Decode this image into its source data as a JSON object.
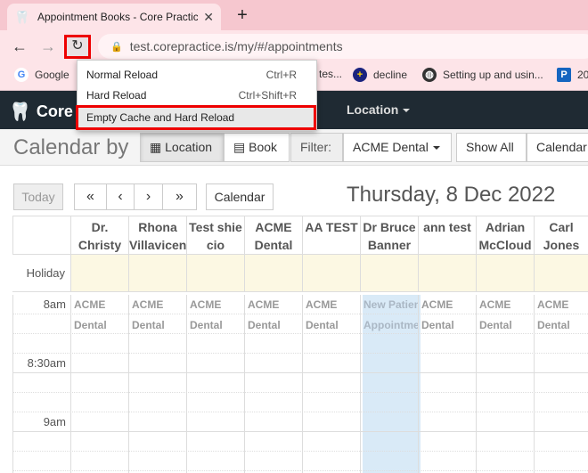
{
  "browser": {
    "tab_title": "Appointment Books - Core Practic",
    "url": "test.corepractice.is/my/#/appointments",
    "bookmarks": [
      "Google",
      "tes...",
      "decline",
      "Setting up and usin...",
      "20"
    ]
  },
  "reload_menu": {
    "items": [
      {
        "label": "Normal Reload",
        "shortcut": "Ctrl+R"
      },
      {
        "label": "Hard Reload",
        "shortcut": "Ctrl+Shift+R"
      },
      {
        "label": "Empty Cache and Hard Reload",
        "shortcut": ""
      }
    ]
  },
  "app": {
    "logo_text": "Core",
    "location_menu": "Location"
  },
  "toolbar": {
    "calendar_by": "Calendar by",
    "location_btn": "Location",
    "book_btn": "Book",
    "filter_label": "Filter:",
    "filter_value": "ACME Dental",
    "show_all": "Show All",
    "calendar_btn": "Calendar"
  },
  "calendar": {
    "today": "Today",
    "prev_week": "«",
    "prev_day": "‹",
    "next_day": "›",
    "next_week": "»",
    "calendar_btn": "Calendar",
    "date": "Thursday, 8 Dec 2022",
    "holiday_label": "Holiday",
    "columns": [
      {
        "l1": "Dr.",
        "l2": "Christy"
      },
      {
        "l1": "Rhona",
        "l2": "Villavicencio"
      },
      {
        "l1": "Test shie",
        "l2": "cio"
      },
      {
        "l1": "ACME",
        "l2": "Dental"
      },
      {
        "l1": "AA TEST",
        "l2": ""
      },
      {
        "l1": "Dr Bruce",
        "l2": "Banner"
      },
      {
        "l1": "ann test",
        "l2": ""
      },
      {
        "l1": "Adrian",
        "l2": "McCloud"
      },
      {
        "l1": "Carl",
        "l2": "Jones"
      }
    ],
    "times": [
      "8am",
      "8:30am",
      "9am"
    ],
    "appointments": [
      {
        "l1": "ACME",
        "l2": "Dental"
      },
      {
        "l1": "ACME",
        "l2": "Dental"
      },
      {
        "l1": "ACME",
        "l2": "Dental"
      },
      {
        "l1": "ACME",
        "l2": "Dental"
      },
      {
        "l1": "ACME",
        "l2": "Dental"
      },
      {
        "l1": "New Patien",
        "l2": "Appointme"
      },
      {
        "l1": "ACME",
        "l2": "Dental"
      },
      {
        "l1": "ACME",
        "l2": "Dental"
      },
      {
        "l1": "ACME",
        "l2": "Dental"
      }
    ]
  }
}
